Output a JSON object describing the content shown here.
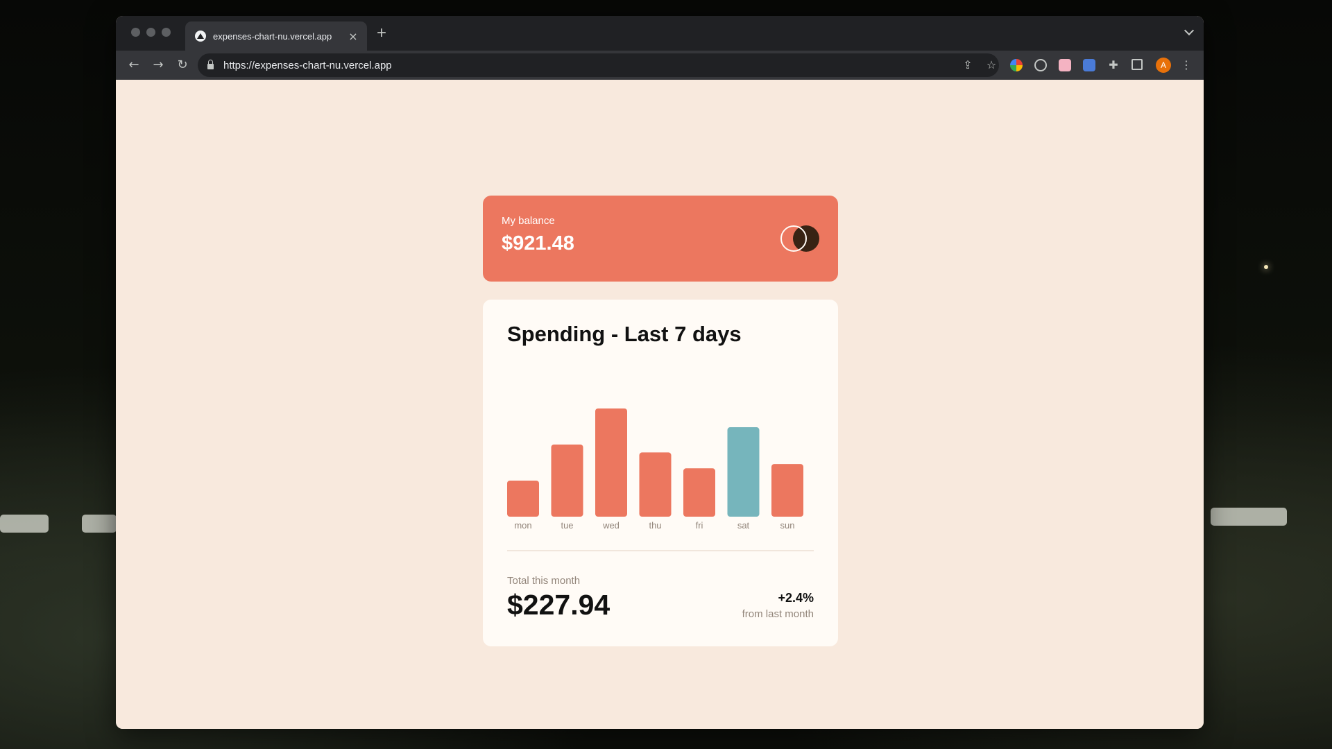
{
  "browser": {
    "tab_title": "expenses-chart-nu.vercel.app",
    "tab_close": "×",
    "new_tab": "+",
    "url": "https://expenses-chart-nu.vercel.app",
    "avatar_letter": "A",
    "icons": [
      "back-icon",
      "forward-icon",
      "reload-icon",
      "lock-icon",
      "share-icon",
      "bookmark-star-icon",
      "extension-icon",
      "puzzle-icon",
      "sidepanel-icon",
      "menu-icon"
    ]
  },
  "balance": {
    "label": "My balance",
    "amount": "$921.48"
  },
  "spending": {
    "title": "Spending - Last 7 days",
    "total_label": "Total this month",
    "total_value": "$227.94",
    "change": "+2.4%",
    "change_label": "from last month"
  },
  "chart_data": {
    "type": "bar",
    "categories": [
      "mon",
      "tue",
      "wed",
      "thu",
      "fri",
      "sat",
      "sun"
    ],
    "values": [
      17.45,
      34.91,
      52.36,
      31.07,
      23.39,
      43.28,
      25.48
    ],
    "highlight_index": 5,
    "colors": {
      "bar": "#ec775f",
      "highlight": "#76b5bc"
    },
    "title": "",
    "xlabel": "",
    "ylabel": ""
  },
  "colors": {
    "page_bg": "#f8e9dd",
    "balance_card": "#ec775f",
    "card_bg": "#fffbf6",
    "muted_text": "#92857a"
  }
}
